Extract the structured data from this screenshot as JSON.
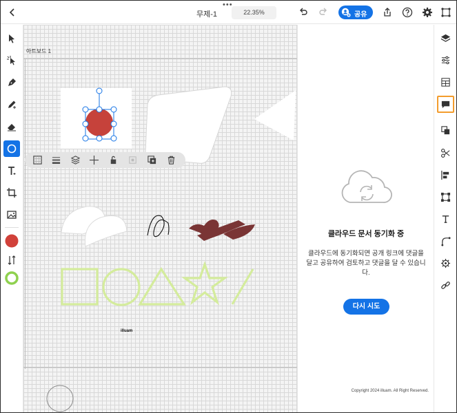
{
  "header": {
    "title": "무제-1",
    "zoom": "22.35%",
    "share_label": "공유",
    "more": "•••"
  },
  "canvas": {
    "artboard_label": "아트보드 1",
    "logo_text": "illuam"
  },
  "panel": {
    "title": "클라우드 문서 동기화 중",
    "message": "클라우드에 동기화되면 공개 링크에 댓글을 달고 공유하여 검토하고 댓글을 달 수 있습니다.",
    "retry_label": "다시 시도",
    "copyright": "Copyright 2024 illuam. All Right Reserved."
  },
  "colors": {
    "accent": "#1473e6",
    "fill_color": "#d1413a",
    "stroke_color": "#8fd14f",
    "highlight": "#f39c2c"
  },
  "left_tools": [
    "select-tool",
    "direct-select-tool",
    "pen-tool",
    "pencil-tool",
    "eraser-tool",
    "ellipse-tool",
    "type-tool",
    "crop-tool",
    "image-tool",
    "fill-swatch",
    "swap-colors",
    "stroke-swatch"
  ],
  "right_rail": [
    "layers",
    "properties",
    "libraries",
    "comments",
    "arrange",
    "cut",
    "align",
    "transform",
    "type-properties",
    "curvature",
    "settings",
    "links"
  ]
}
